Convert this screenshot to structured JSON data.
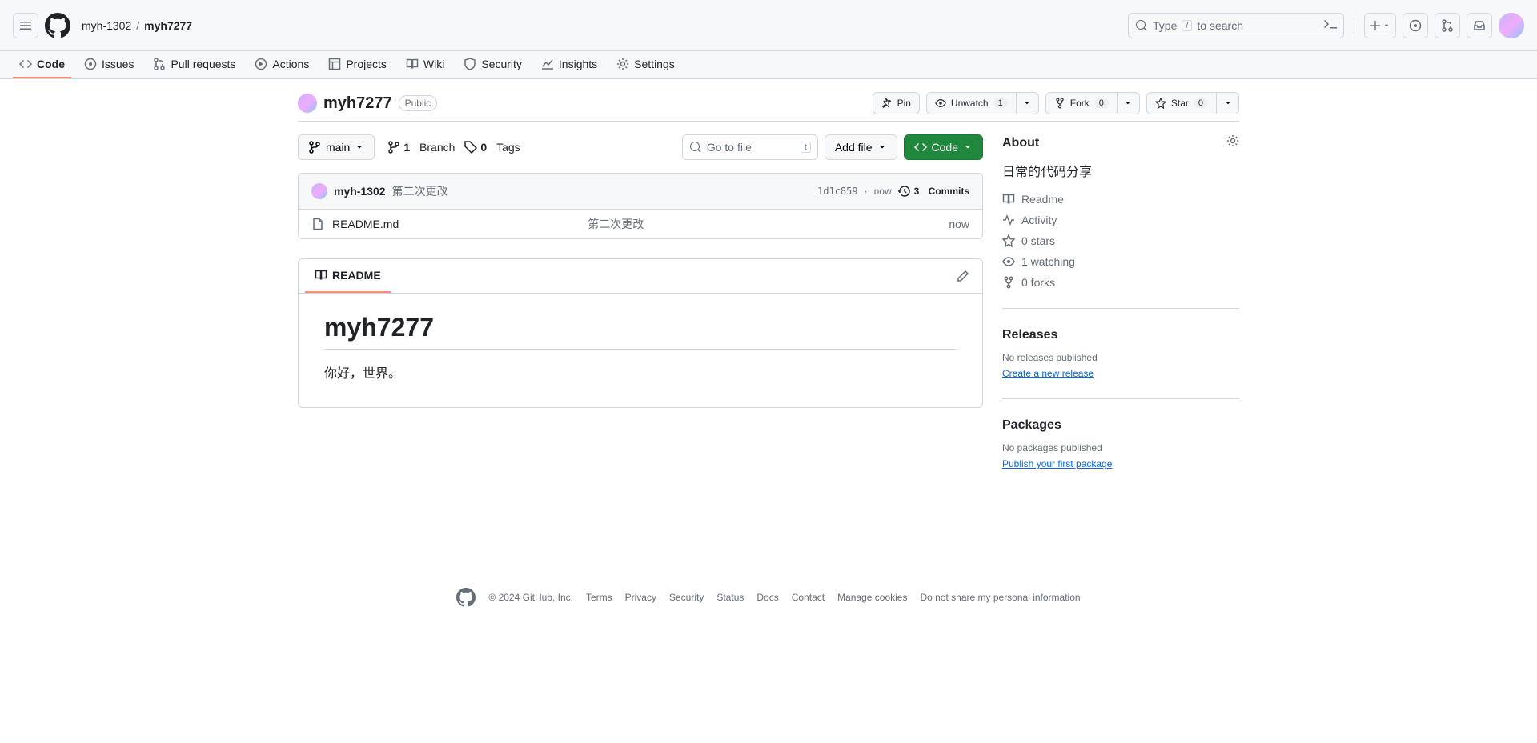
{
  "header": {
    "breadcrumb": {
      "owner": "myh-1302",
      "sep": "/",
      "repo": "myh7277"
    },
    "search": {
      "prefix": "Type",
      "key": "/",
      "suffix": "to search"
    }
  },
  "nav": {
    "tabs": [
      {
        "label": "Code",
        "icon": "code-icon"
      },
      {
        "label": "Issues",
        "icon": "issues-icon"
      },
      {
        "label": "Pull requests",
        "icon": "pr-icon"
      },
      {
        "label": "Actions",
        "icon": "actions-icon"
      },
      {
        "label": "Projects",
        "icon": "projects-icon"
      },
      {
        "label": "Wiki",
        "icon": "wiki-icon"
      },
      {
        "label": "Security",
        "icon": "security-icon"
      },
      {
        "label": "Insights",
        "icon": "insights-icon"
      },
      {
        "label": "Settings",
        "icon": "settings-icon"
      }
    ],
    "active": 0
  },
  "repo": {
    "name": "myh7277",
    "visibility": "Public",
    "actions": {
      "pin": "Pin",
      "unwatch": "Unwatch",
      "watch_count": "1",
      "fork": "Fork",
      "fork_count": "0",
      "star": "Star",
      "star_count": "0"
    }
  },
  "toolbar": {
    "branch": "main",
    "branches_count": "1",
    "branches_label": "Branch",
    "tags_count": "0",
    "tags_label": "Tags",
    "search_placeholder": "Go to file",
    "search_kbd": "t",
    "addfile": "Add file",
    "code": "Code"
  },
  "commit": {
    "author": "myh-1302",
    "message": "第二次更改",
    "hash": "1d1c859",
    "when_sep": "·",
    "when": "now",
    "commits_count": "3",
    "commits_label": "Commits"
  },
  "files": [
    {
      "name": "README.md",
      "message": "第二次更改",
      "when": "now"
    }
  ],
  "readme": {
    "tab": "README",
    "title": "myh7277",
    "body": "你好，世界。"
  },
  "sidebar": {
    "about_title": "About",
    "description": "日常的代码分享",
    "links": {
      "readme": "Readme",
      "activity": "Activity",
      "stars": "0 stars",
      "watching": "1 watching",
      "forks": "0 forks"
    },
    "releases_title": "Releases",
    "releases_note": "No releases published",
    "releases_link": "Create a new release",
    "packages_title": "Packages",
    "packages_note": "No packages published",
    "packages_link": "Publish your first package"
  },
  "footer": {
    "copyright": "© 2024 GitHub, Inc.",
    "links": [
      "Terms",
      "Privacy",
      "Security",
      "Status",
      "Docs",
      "Contact",
      "Manage cookies",
      "Do not share my personal information"
    ]
  }
}
